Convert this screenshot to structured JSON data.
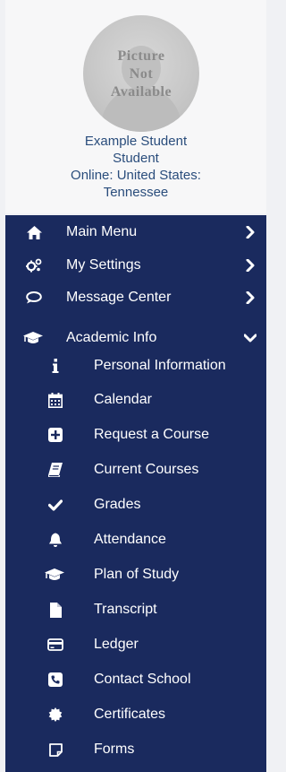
{
  "profile": {
    "avatar_text_line1": "Picture",
    "avatar_text_line2": "Not",
    "avatar_text_line3": "Available",
    "name_line1": "Example Student",
    "name_line2": "Student",
    "status_line1": "Online: United States:",
    "status_line2": "Tennessee"
  },
  "nav": {
    "colors": {
      "background": "#1a2a5e",
      "text": "#ffffff"
    },
    "main_menu": {
      "label": "Main Menu",
      "icon": "home-icon",
      "state": "collapsed"
    },
    "my_settings": {
      "label": "My Settings",
      "icon": "gears-icon",
      "state": "collapsed"
    },
    "message_center": {
      "label": "Message Center",
      "icon": "chat-icon",
      "state": "collapsed"
    },
    "academic_info": {
      "label": "Academic Info",
      "icon": "graduation-cap-icon",
      "state": "expanded",
      "items": [
        {
          "label": "Personal Information",
          "icon": "info-icon"
        },
        {
          "label": "Calendar",
          "icon": "calendar-icon"
        },
        {
          "label": "Request a Course",
          "icon": "plus-square-icon"
        },
        {
          "label": "Current Courses",
          "icon": "book-icon"
        },
        {
          "label": "Grades",
          "icon": "check-icon"
        },
        {
          "label": "Attendance",
          "icon": "bell-icon"
        },
        {
          "label": "Plan of Study",
          "icon": "graduation-cap-icon"
        },
        {
          "label": "Transcript",
          "icon": "file-icon"
        },
        {
          "label": "Ledger",
          "icon": "credit-card-icon"
        },
        {
          "label": "Contact School",
          "icon": "phone-icon"
        },
        {
          "label": "Certificates",
          "icon": "certificate-icon"
        },
        {
          "label": "Forms",
          "icon": "note-icon"
        }
      ]
    }
  }
}
